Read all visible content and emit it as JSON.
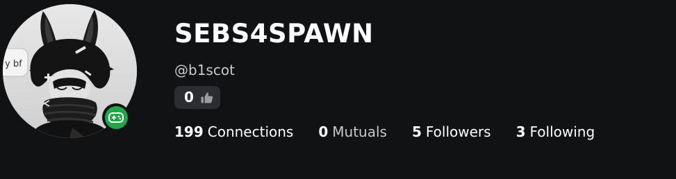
{
  "profile": {
    "display_name": "SEBS4SPAWN",
    "username": "@b1scot",
    "avatar_icon": "user-avatar",
    "avatar_bubble_text": "y bf",
    "presence": {
      "status": "in-game",
      "icon": "gamepad-icon",
      "color": "#1ea84a"
    },
    "votes": {
      "count": "0",
      "icon": "thumbs-up-icon"
    },
    "stats": {
      "connections": {
        "count": "199",
        "label": "Connections"
      },
      "mutuals": {
        "count": "0",
        "label": "Mutuals"
      },
      "followers": {
        "count": "5",
        "label": "Followers"
      },
      "following": {
        "count": "3",
        "label": "Following"
      }
    }
  },
  "colors": {
    "background": "#111214",
    "chip_background": "#2b2d31",
    "muted_text": "#c8c9cc",
    "presence_green": "#1ea84a"
  }
}
